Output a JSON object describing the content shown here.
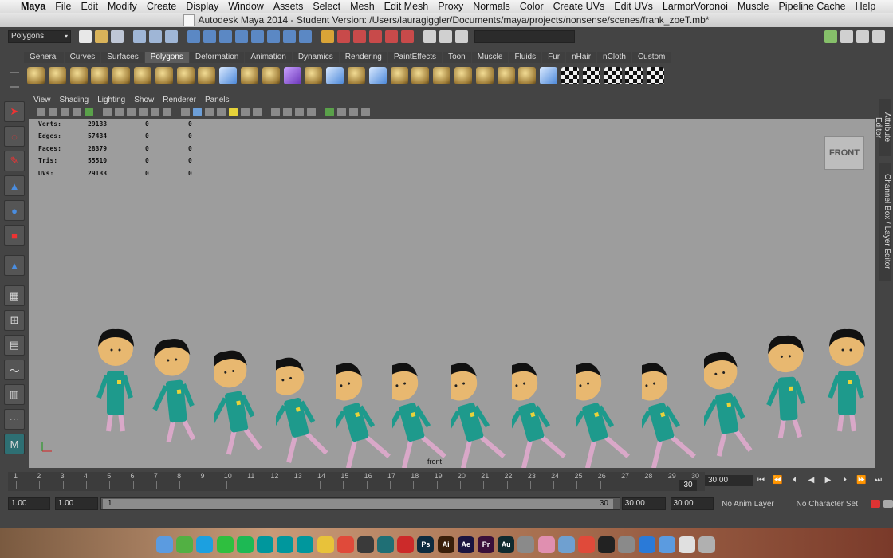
{
  "menubar": {
    "app": "Maya",
    "items": [
      "File",
      "Edit",
      "Modify",
      "Create",
      "Display",
      "Window",
      "Assets",
      "Select",
      "Mesh",
      "Edit Mesh",
      "Proxy",
      "Normals",
      "Color",
      "Create UVs",
      "Edit UVs",
      "LarmorVoronoi",
      "Muscle",
      "Pipeline Cache",
      "Help"
    ]
  },
  "window": {
    "title": "Autodesk Maya 2014 - Student Version: /Users/lauragiggler/Documents/maya/projects/nonsense/scenes/frank_zoeT.mb*"
  },
  "status_line": {
    "mode": "Polygons"
  },
  "shelf": {
    "tabs": [
      "General",
      "Curves",
      "Surfaces",
      "Polygons",
      "Deformation",
      "Animation",
      "Dynamics",
      "Rendering",
      "PaintEffects",
      "Toon",
      "Muscle",
      "Fluids",
      "Fur",
      "nHair",
      "nCloth",
      "Custom"
    ],
    "active_tab": "Polygons"
  },
  "panel_menu": [
    "View",
    "Shading",
    "Lighting",
    "Show",
    "Renderer",
    "Panels"
  ],
  "hud": {
    "rows": [
      {
        "label": "Verts:",
        "a": "29133",
        "b": "0",
        "c": "0"
      },
      {
        "label": "Edges:",
        "a": "57434",
        "b": "0",
        "c": "0"
      },
      {
        "label": "Faces:",
        "a": "28379",
        "b": "0",
        "c": "0"
      },
      {
        "label": "Tris:",
        "a": "55510",
        "b": "0",
        "c": "0"
      },
      {
        "label": "UVs:",
        "a": "29133",
        "b": "0",
        "c": "0"
      }
    ]
  },
  "viewcube_label": "FRONT",
  "camera_label": "front",
  "side_tabs": {
    "attribute_editor": "Attribute Editor",
    "channel_box": "Channel Box / Layer Editor"
  },
  "time_slider": {
    "ticks": [
      "1",
      "2",
      "3",
      "4",
      "5",
      "6",
      "7",
      "8",
      "9",
      "10",
      "11",
      "12",
      "13",
      "14",
      "15",
      "16",
      "17",
      "18",
      "19",
      "20",
      "21",
      "22",
      "23",
      "24",
      "25",
      "26",
      "27",
      "28",
      "29",
      "30"
    ],
    "current_frame_marker": "30",
    "current_time": "30.00"
  },
  "range_slider": {
    "start_time": "1.00",
    "playback_start": "1.00",
    "range_start_label": "1",
    "range_end_label": "30",
    "playback_end": "30.00",
    "end_time": "30.00",
    "anim_layer": "No Anim Layer",
    "character_set": "No Character Set"
  },
  "dock": [
    "Finder",
    "Evernote",
    "Skype",
    "LINE",
    "Spotify",
    "Arduino",
    "Arduino",
    "Arduino",
    "Cyberduck",
    "Chrome",
    "Sublime",
    "Maya",
    "Flash",
    "Ps",
    "Ai",
    "Ae",
    "Pr",
    "Au",
    "Migration",
    "Photos",
    "Preview",
    "Chrome",
    "Terminal",
    "Utility",
    "Xcode",
    "Finder",
    "Files",
    "Trash"
  ]
}
